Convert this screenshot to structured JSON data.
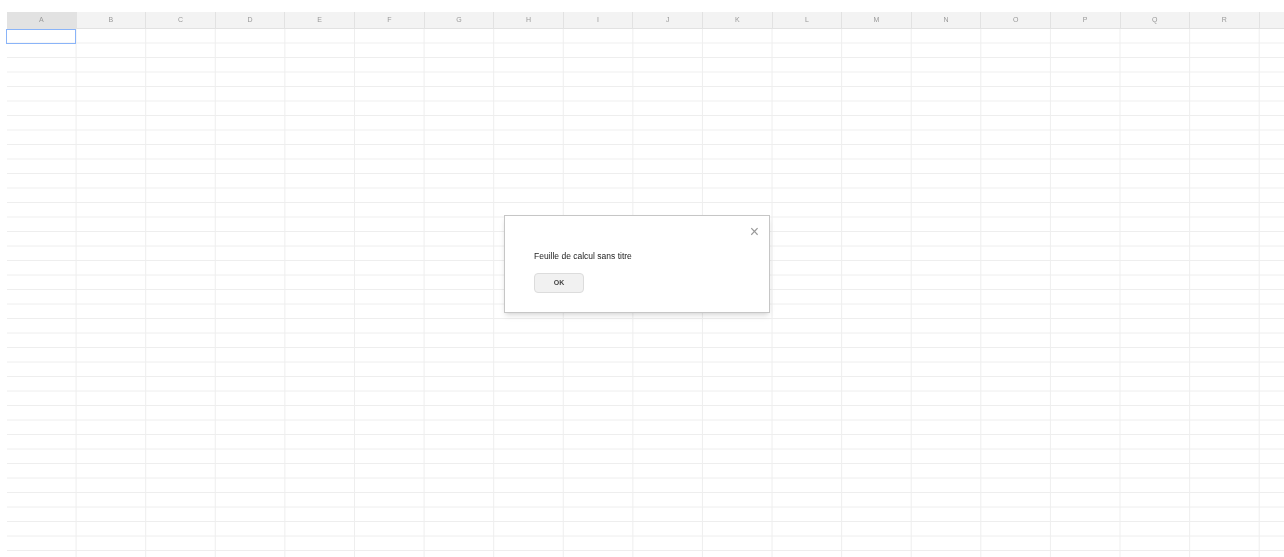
{
  "columns": [
    {
      "label": "A",
      "selected": true
    },
    {
      "label": "B",
      "selected": false
    },
    {
      "label": "C",
      "selected": false
    },
    {
      "label": "D",
      "selected": false
    },
    {
      "label": "E",
      "selected": false
    },
    {
      "label": "F",
      "selected": false
    },
    {
      "label": "G",
      "selected": false
    },
    {
      "label": "H",
      "selected": false
    },
    {
      "label": "I",
      "selected": false
    },
    {
      "label": "J",
      "selected": false
    },
    {
      "label": "K",
      "selected": false
    },
    {
      "label": "L",
      "selected": false
    },
    {
      "label": "M",
      "selected": false
    },
    {
      "label": "N",
      "selected": false
    },
    {
      "label": "O",
      "selected": false
    },
    {
      "label": "P",
      "selected": false
    },
    {
      "label": "Q",
      "selected": false
    },
    {
      "label": "R",
      "selected": false
    }
  ],
  "dialog": {
    "message": "Feuille de calcul sans titre",
    "close": "×",
    "button": "OK"
  }
}
